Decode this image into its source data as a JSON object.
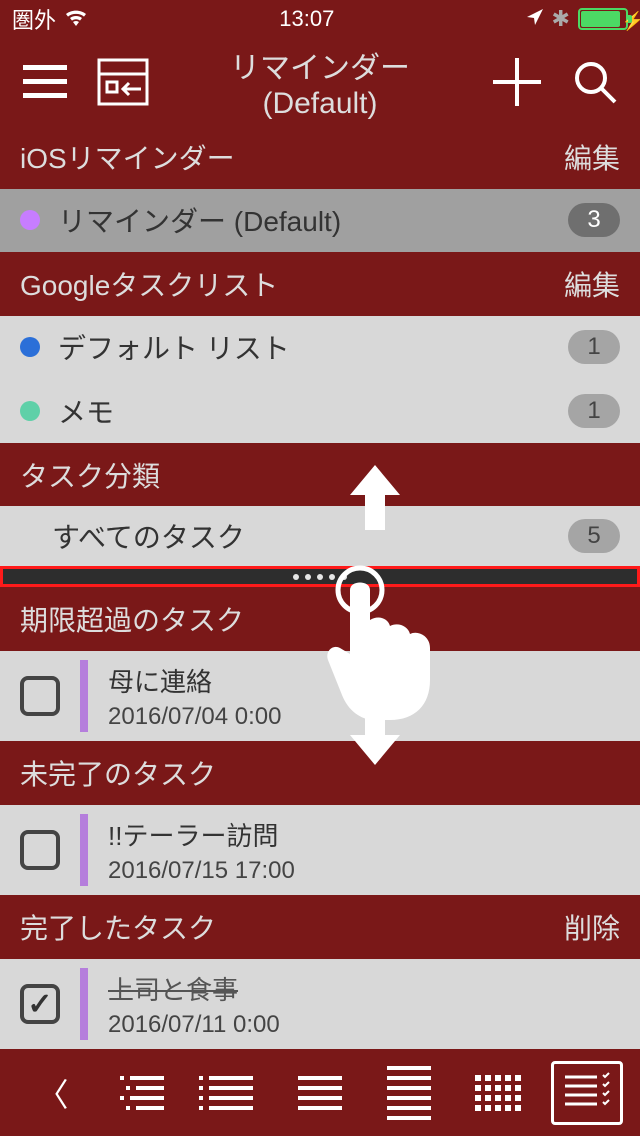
{
  "status": {
    "carrier": "圏外",
    "time": "13:07"
  },
  "nav": {
    "title": "リマインダー (Default)"
  },
  "sections": {
    "ios": {
      "title": "iOSリマインダー",
      "action": "編集"
    },
    "google": {
      "title": "Googleタスクリスト",
      "action": "編集"
    },
    "category": {
      "title": "タスク分類"
    },
    "overdue": {
      "title": "期限超過のタスク"
    },
    "incomplete": {
      "title": "未完了のタスク"
    },
    "completed": {
      "title": "完了したタスク",
      "action": "削除"
    }
  },
  "lists": {
    "ios": [
      {
        "label": "リマインダー (Default)",
        "count": "3",
        "color": "#c77dff"
      }
    ],
    "google": [
      {
        "label": "デフォルト リスト",
        "count": "1",
        "color": "#2b6fd8"
      },
      {
        "label": "メモ",
        "count": "1",
        "color": "#5fd0a8"
      }
    ],
    "category": [
      {
        "label": "すべてのタスク",
        "count": "5"
      }
    ]
  },
  "tasks": {
    "overdue": [
      {
        "title": "母に連絡",
        "date": "2016/07/04 0:00",
        "done": false
      }
    ],
    "incomplete": [
      {
        "title": "!!テーラー訪問",
        "date": "2016/07/15 17:00",
        "done": false
      }
    ],
    "completed": [
      {
        "title": "上司と食事",
        "date": "2016/07/11 0:00",
        "done": true
      }
    ]
  }
}
